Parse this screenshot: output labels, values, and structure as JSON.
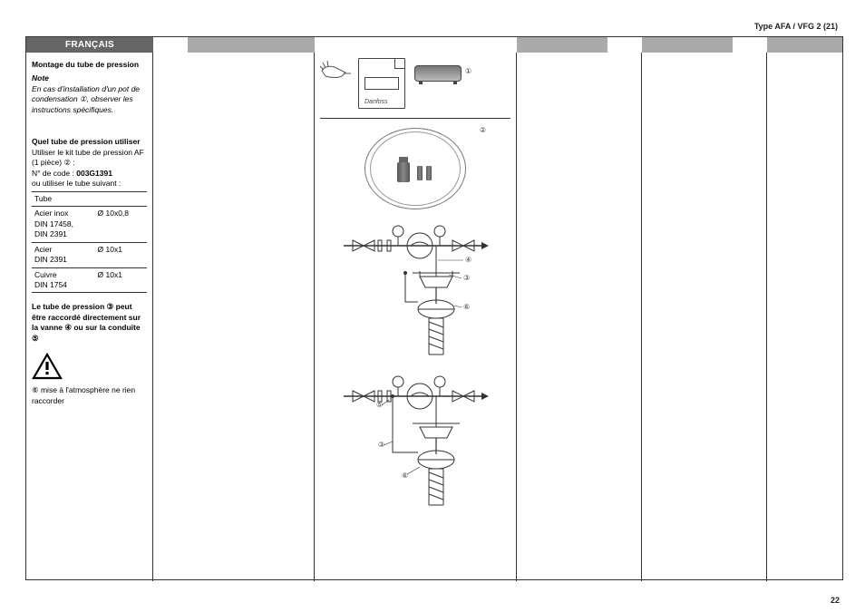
{
  "header": {
    "type_label": "Type AFA / VFG 2 (21)"
  },
  "page_number": "22",
  "tabs": {
    "francais": "FRANÇAIS"
  },
  "francais": {
    "montage_title": "Montage du tube de pression",
    "note_label": "Note",
    "note_body": "En cas d'installation d'un pot de condensation ①, observer les instructions spécifiques.",
    "quel_title": "Quel tube de pression utiliser",
    "quel_line1": "Utiliser le kit tube de pression AF (1 pièce) ② :",
    "quel_code_prefix": "N° de code : ",
    "quel_code": "003G1391",
    "quel_alt": "ou utiliser le tube suivant :",
    "table": {
      "header": "Tube",
      "rows": [
        {
          "material": "Acier inox\nDIN 17458,\nDIN 2391",
          "size": "Ø 10x0,8"
        },
        {
          "material": "Acier\nDIN 2391",
          "size": "Ø 10x1"
        },
        {
          "material": "Cuivre\nDIN 1754",
          "size": "Ø 10x1"
        }
      ]
    },
    "tube_note": "Le tube de pression ③ peut être raccordé directement sur la vanne ④ ou sur la conduite ⑤",
    "atm_note": "⑥ mise à l'atmosphère ne rien raccorder"
  },
  "illus": {
    "doc_brand": "Danfoss",
    "label_1": "①",
    "label_2": "②",
    "label_3": "③",
    "label_4": "④",
    "label_5": "⑤",
    "label_6": "⑥"
  }
}
